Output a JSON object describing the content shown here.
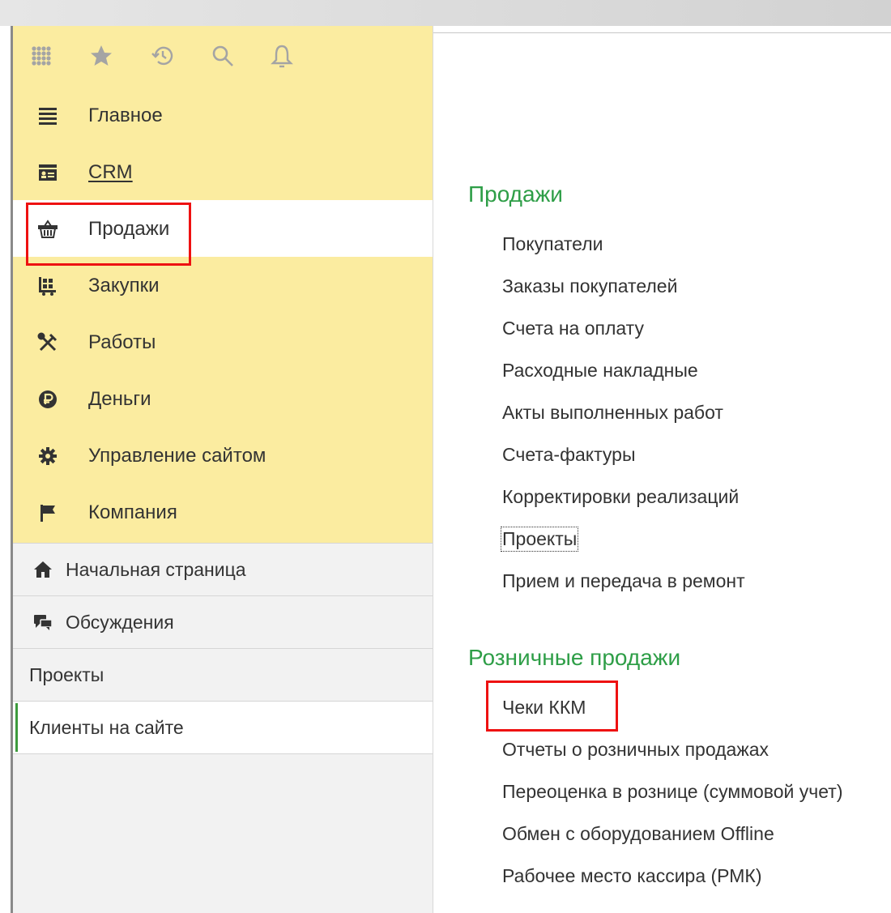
{
  "toolbar": {
    "icons": [
      "apps-grid-icon",
      "star-icon",
      "history-icon",
      "search-icon",
      "bell-icon"
    ]
  },
  "sections": [
    {
      "label": "Главное",
      "icon": "menu-lines-icon"
    },
    {
      "label": "CRM",
      "icon": "contact-card-icon"
    },
    {
      "label": "Продажи",
      "icon": "basket-icon",
      "active": true
    },
    {
      "label": "Закупки",
      "icon": "cart-icon"
    },
    {
      "label": "Работы",
      "icon": "tools-icon"
    },
    {
      "label": "Деньги",
      "icon": "ruble-icon"
    },
    {
      "label": "Управление сайтом",
      "icon": "gear-icon"
    },
    {
      "label": "Компания",
      "icon": "flag-icon"
    }
  ],
  "nav": [
    {
      "label": "Начальная страница",
      "icon": "home-icon"
    },
    {
      "label": "Обсуждения",
      "icon": "chat-icon"
    },
    {
      "label": "Проекты"
    },
    {
      "label": "Клиенты на сайте",
      "active": true
    }
  ],
  "content": {
    "groups": [
      {
        "title": "Продажи",
        "links": [
          "Покупатели",
          "Заказы покупателей",
          "Счета на оплату",
          "Расходные накладные",
          "Акты выполненных работ",
          "Счета-фактуры",
          "Корректировки реализаций",
          "Проекты",
          "Прием и передача в ремонт"
        ]
      },
      {
        "title": "Розничные продажи",
        "links": [
          "Чеки ККМ",
          "Отчеты о розничных продажах",
          "Переоценка в рознице (суммовой учет)",
          "Обмен с оборудованием Offline",
          "Рабочее место кассира (РМК)"
        ]
      }
    ]
  },
  "colors": {
    "accent_green": "#2e9e47",
    "section_bg": "#fbeca0",
    "highlight_red": "#ee1111"
  }
}
